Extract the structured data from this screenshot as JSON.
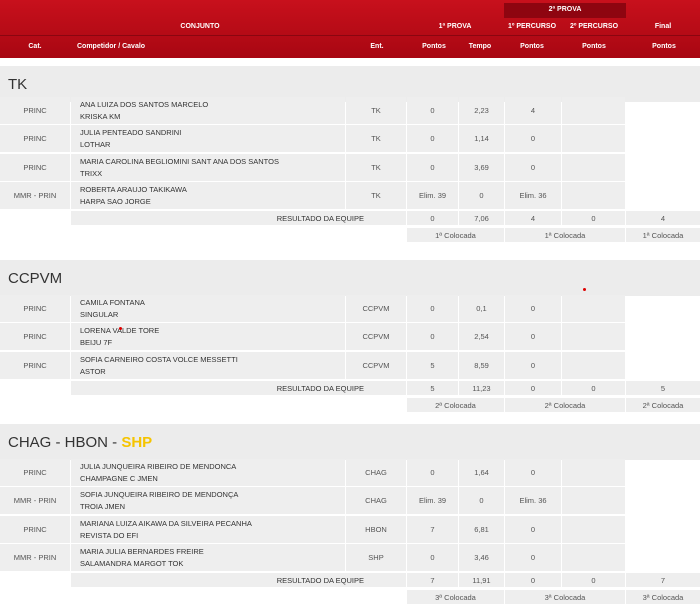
{
  "header": {
    "conjunto": "CONJUNTO",
    "segunda_prova": "2ª PROVA",
    "primeira_prova": "1ª PROVA",
    "primeiro_percurso": "1º PERCURSO",
    "segundo_percurso": "2º PERCURSO",
    "final": "Final",
    "cols": {
      "cat": "Cat.",
      "competidor": "Competidor / Cavalo",
      "ent": "Ent.",
      "pontos1": "Pontos",
      "tempo": "Tempo",
      "pontos2": "Pontos",
      "pontos3": "Pontos",
      "pontos4": "Pontos"
    }
  },
  "teams": [
    {
      "name": "TK",
      "name_highlight": "",
      "rows": [
        {
          "cat": "PRINC",
          "rider": "ANA LUIZA DOS SANTOS MARCELO",
          "horse": "KRISKA KM",
          "ent": "TK",
          "pontos": "0",
          "tempo": "2,23",
          "p1": "4"
        },
        {
          "cat": "PRINC",
          "rider": "JULIA PENTEADO SANDRINI",
          "horse": "LOTHAR",
          "ent": "TK",
          "pontos": "0",
          "tempo": "1,14",
          "p1": "0"
        },
        {
          "cat": "PRINC",
          "rider": "MARIA CAROLINA BEGLIOMINI SANT ANA DOS SANTOS",
          "horse": "TRIXX",
          "ent": "TK",
          "pontos": "0",
          "tempo": "3,69",
          "p1": "0"
        },
        {
          "cat": "MMR - PRIN",
          "rider": "ROBERTA ARAUJO TAKIKAWA",
          "horse": "HARPA SAO JORGE",
          "ent": "TK",
          "pontos": "Elim. 39",
          "tempo": "0",
          "p1": "Elim. 36"
        }
      ],
      "result": {
        "label": "RESULTADO DA EQUIPE",
        "pontos": "0",
        "tempo": "7,06",
        "p1": "4",
        "p2": "0",
        "final": "4"
      },
      "placing": {
        "a": "1ª Colocada",
        "b": "1ª Colocada",
        "c": "1ª Colocada"
      }
    },
    {
      "name": "CCPVM",
      "name_highlight": "",
      "rows": [
        {
          "cat": "PRINC",
          "rider": "CAMILA FONTANA",
          "horse": "SINGULAR",
          "ent": "CCPVM",
          "pontos": "0",
          "tempo": "0,1",
          "p1": "0"
        },
        {
          "cat": "PRINC",
          "rider": "LORENA VALDE TORE",
          "horse": "BEIJU 7F",
          "ent": "CCPVM",
          "pontos": "0",
          "tempo": "2,54",
          "p1": "0"
        },
        {
          "cat": "PRINC",
          "rider": "SOFIA CARNEIRO COSTA VOLCE MESSETTI",
          "horse": "ASTOR",
          "ent": "CCPVM",
          "pontos": "5",
          "tempo": "8,59",
          "p1": "0"
        }
      ],
      "result": {
        "label": "RESULTADO DA EQUIPE",
        "pontos": "5",
        "tempo": "11,23",
        "p1": "0",
        "p2": "0",
        "final": "5"
      },
      "placing": {
        "a": "2ª Colocada",
        "b": "2ª Colocada",
        "c": "2ª Colocada"
      }
    },
    {
      "name": "CHAG - HBON - ",
      "name_highlight": "SHP",
      "rows": [
        {
          "cat": "PRINC",
          "rider": "JULIA JUNQUEIRA RIBEIRO DE MENDONCA",
          "horse": "CHAMPAGNE C JMEN",
          "ent": "CHAG",
          "pontos": "0",
          "tempo": "1,64",
          "p1": "0"
        },
        {
          "cat": "MMR - PRIN",
          "rider": "SOFIA JUNQUEIRA RIBEIRO DE MENDONÇA",
          "horse": "TROIA JMEN",
          "ent": "CHAG",
          "pontos": "Elim. 39",
          "tempo": "0",
          "p1": "Elim. 36"
        },
        {
          "cat": "PRINC",
          "rider": "MARIANA LUIZA AIKAWA DA SILVEIRA PECANHA",
          "horse": "REVISTA DO EFI",
          "ent": "HBON",
          "pontos": "7",
          "tempo": "6,81",
          "p1": "0"
        },
        {
          "cat": "MMR - PRIN",
          "rider": "MARIA JULIA BERNARDES FREIRE",
          "horse": "SALAMANDRA MARGOT TOK",
          "ent": "SHP",
          "pontos": "0",
          "tempo": "3,46",
          "p1": "0"
        }
      ],
      "result": {
        "label": "RESULTADO DA EQUIPE",
        "pontos": "7",
        "tempo": "11,91",
        "p1": "0",
        "p2": "0",
        "final": "7"
      },
      "placing": {
        "a": "3ª Colocada",
        "b": "3ª Colocada",
        "c": "3ª Colocada"
      }
    }
  ]
}
